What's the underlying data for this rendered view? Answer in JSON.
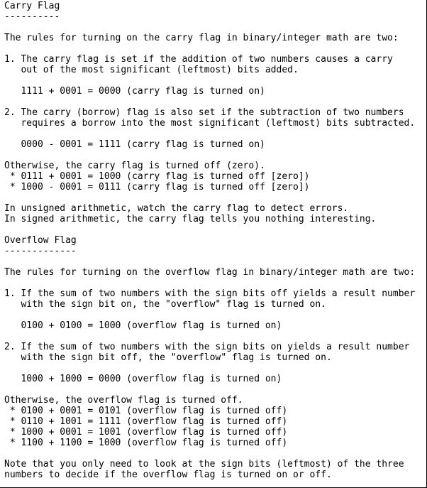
{
  "document": {
    "lines": [
      "Carry Flag",
      "----------",
      "",
      "The rules for turning on the carry flag in binary/integer math are two:",
      "",
      "1. The carry flag is set if the addition of two numbers causes a carry",
      "   out of the most significant (leftmost) bits added.",
      "",
      "   1111 + 0001 = 0000 (carry flag is turned on)",
      "",
      "2. The carry (borrow) flag is also set if the subtraction of two numbers",
      "   requires a borrow into the most significant (leftmost) bits subtracted.",
      "",
      "   0000 - 0001 = 1111 (carry flag is turned on)",
      "",
      "Otherwise, the carry flag is turned off (zero).",
      " * 0111 + 0001 = 1000 (carry flag is turned off [zero])",
      " * 1000 - 0001 = 0111 (carry flag is turned off [zero])",
      "",
      "In unsigned arithmetic, watch the carry flag to detect errors.",
      "In signed arithmetic, the carry flag tells you nothing interesting.",
      "",
      "Overflow Flag",
      "-------------",
      "",
      "The rules for turning on the overflow flag in binary/integer math are two:",
      "",
      "1. If the sum of two numbers with the sign bits off yields a result number",
      "   with the sign bit on, the \"overflow\" flag is turned on.",
      "",
      "   0100 + 0100 = 1000 (overflow flag is turned on)",
      "",
      "2. If the sum of two numbers with the sign bits on yields a result number",
      "   with the sign bit off, the \"overflow\" flag is turned on.",
      "",
      "   1000 + 1000 = 0000 (overflow flag is turned on)",
      "",
      "Otherwise, the overflow flag is turned off.",
      " * 0100 + 0001 = 0101 (overflow flag is turned off)",
      " * 0110 + 1001 = 1111 (overflow flag is turned off)",
      " * 1000 + 0001 = 1001 (overflow flag is turned off)",
      " * 1100 + 1100 = 1000 (overflow flag is turned off)",
      "",
      "Note that you only need to look at the sign bits (leftmost) of the three",
      "numbers to decide if the overflow flag is turned on or off."
    ]
  }
}
